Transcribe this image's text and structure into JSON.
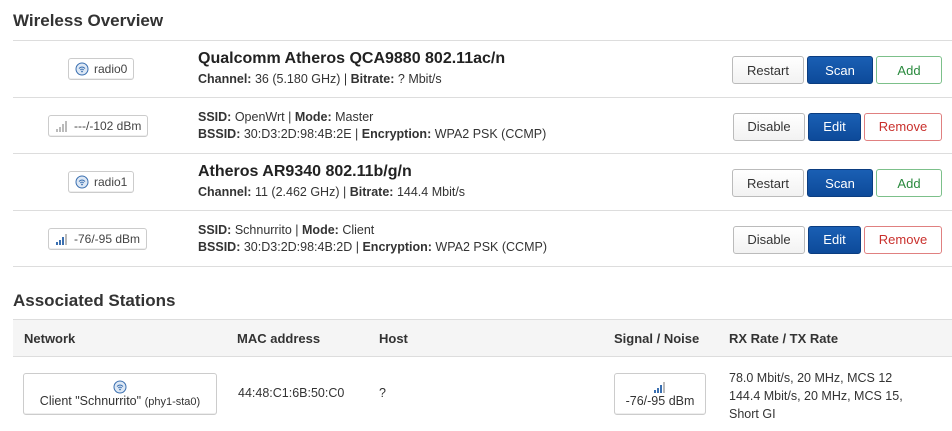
{
  "wireless": {
    "title": "Wireless Overview",
    "devices": [
      {
        "radio": "radio0",
        "name": "Qualcomm Atheros QCA9880 802.11ac/n",
        "channel_label": "Channel:",
        "channel": "36 (5.180 GHz)",
        "sep": " | ",
        "bitrate_label": "Bitrate:",
        "bitrate": "? Mbit/s",
        "buttons": {
          "restart": "Restart",
          "scan": "Scan",
          "add": "Add"
        },
        "network": {
          "signal": "---/-102 dBm",
          "ssid_label": "SSID:",
          "ssid": "OpenWrt",
          "mode_label": "Mode:",
          "mode": "Master",
          "bssid_label": "BSSID:",
          "bssid": "30:D3:2D:98:4B:2E",
          "enc_label": "Encryption:",
          "enc": "WPA2 PSK (CCMP)",
          "buttons": {
            "disable": "Disable",
            "edit": "Edit",
            "remove": "Remove"
          }
        }
      },
      {
        "radio": "radio1",
        "name": "Atheros AR9340 802.11b/g/n",
        "channel_label": "Channel:",
        "channel": "11 (2.462 GHz)",
        "sep": " | ",
        "bitrate_label": "Bitrate:",
        "bitrate": "144.4 Mbit/s",
        "buttons": {
          "restart": "Restart",
          "scan": "Scan",
          "add": "Add"
        },
        "network": {
          "signal": "-76/-95 dBm",
          "ssid_label": "SSID:",
          "ssid": "Schnurrito",
          "mode_label": "Mode:",
          "mode": "Client",
          "bssid_label": "BSSID:",
          "bssid": "30:D3:2D:98:4B:2D",
          "enc_label": "Encryption:",
          "enc": "WPA2 PSK (CCMP)",
          "buttons": {
            "disable": "Disable",
            "edit": "Edit",
            "remove": "Remove"
          }
        }
      }
    ]
  },
  "stations": {
    "title": "Associated Stations",
    "headers": [
      "Network",
      "MAC address",
      "Host",
      "Signal / Noise",
      "RX Rate / TX Rate"
    ],
    "rows": [
      {
        "network": "Client \"Schnurrito\"",
        "network_dev": "(phy1-sta0)",
        "mac": "44:48:C1:6B:50:C0",
        "host": "?",
        "signal": "-76/-95 dBm",
        "rx": "78.0 Mbit/s, 20 MHz, MCS 12",
        "tx": "144.4 Mbit/s, 20 MHz, MCS 15,",
        "tx2": "Short GI"
      }
    ]
  },
  "colors": {
    "primary": "#0d4a9a",
    "add": "#2a8a3e",
    "remove": "#c9302c",
    "wifi_icon": "#3a6fb0"
  }
}
